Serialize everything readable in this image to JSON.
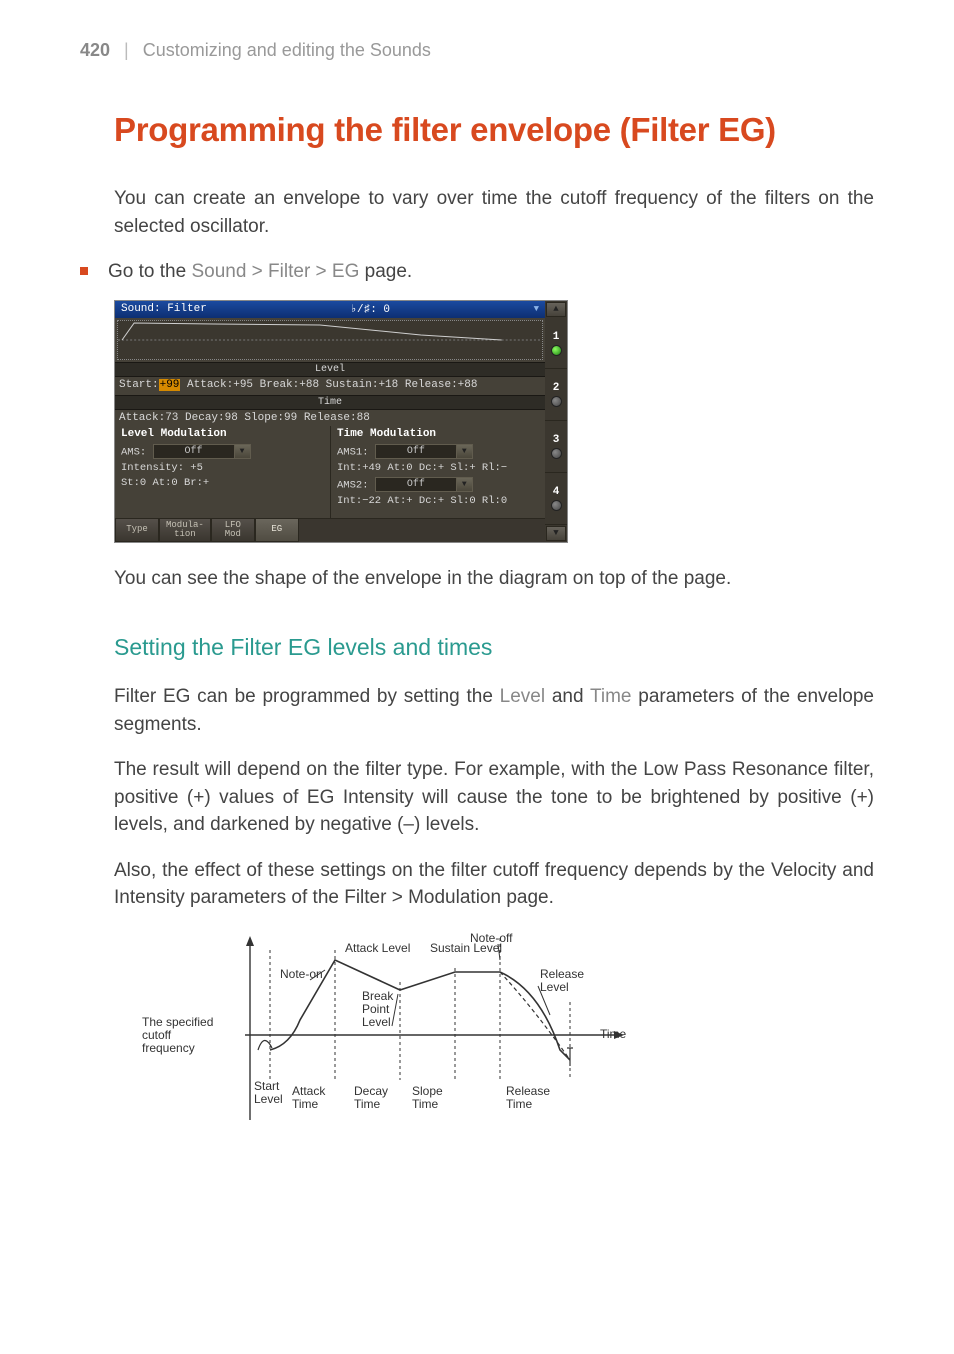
{
  "header": {
    "page_num": "420",
    "bar": "|",
    "title": "Customizing and editing the Sounds"
  },
  "h1": "Programming the filter envelope (Filter EG)",
  "intro": "You can create an envelope to vary over time the cutoff frequency of the filters on the selected oscillator.",
  "bullet": {
    "prefix": "Go to the ",
    "path": "Sound > Filter > EG",
    "suffix": " page."
  },
  "panel": {
    "title_left": "Sound: Filter",
    "title_mid": "♭/♯: 0",
    "level_label": "Level",
    "level_row_1a": "Start:",
    "level_row_1_hl": "+99",
    "level_row_1b": " Attack:+95  Break:+88  Sustain:+18  Release:+88",
    "time_label": "Time",
    "time_row": "Attack:73  Decay:98   Slope:99   Release:88",
    "lm_head": "Level Modulation",
    "lm_ams_label": "AMS:",
    "lm_ams_val": "Off",
    "lm_intensity": "Intensity: +5",
    "lm_row": "St:0   At:0   Br:+",
    "tm_head": "Time Modulation",
    "tm_ams1_label": "AMS1:",
    "tm_ams1_val": "Off",
    "tm_row1": "Int:+49  At:0  Dc:+  Sl:+  Rl:−",
    "tm_ams2_label": "AMS2:",
    "tm_ams2_val": "Off",
    "tm_row2": "Int:−22  At:+  Dc:+  Sl:0  Rl:0",
    "tabs": {
      "t1": "Type",
      "t2": "Modula-\ntion",
      "t3": "LFO\nMod",
      "t4": "EG"
    },
    "side_nums": [
      "1",
      "2",
      "3",
      "4"
    ]
  },
  "after_panel": "You can see the shape of the envelope in the diagram on top of the page.",
  "h2": "Setting the Filter EG levels and times",
  "p2a": "Filter EG can be programmed by setting the ",
  "p2_level": "Level",
  "p2b": " and ",
  "p2_time": "Time",
  "p2c": " parameters of the envelope segments.",
  "p3": "The result will depend on the filter type. For example, with the Low Pass Resonance filter, positive (+) values of EG Intensity will cause the tone to be brightened by positive (+) levels, and darkened by negative (–) levels.",
  "p4": "Also, the effect of these settings on the filter cutoff frequency depends by the Velocity and Intensity parameters of the Filter > Modulation page.",
  "fig": {
    "note_on": "Note-on",
    "attack_level": "Attack Level",
    "sustain_level": "Sustain Level",
    "note_off": "Note-off",
    "release_level": "Release\nLevel",
    "break_point": "Break\nPoint\nLevel",
    "time": "Time",
    "cutoff": "The specified\ncutoff\nfrequency",
    "start_level": "Start\nLevel",
    "attack_time": "Attack\nTime",
    "decay_time": "Decay\nTime",
    "slope_time": "Slope\nTime",
    "release_time": "Release\nTime"
  }
}
